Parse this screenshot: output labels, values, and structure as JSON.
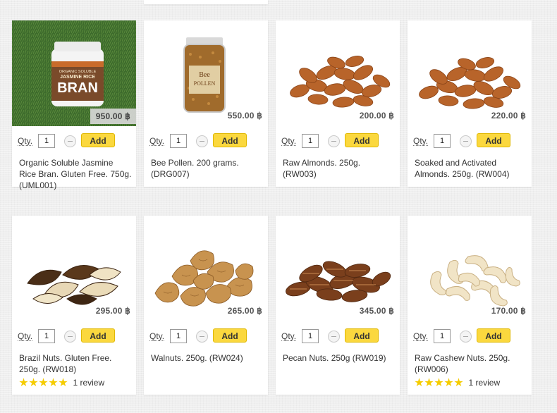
{
  "products": [
    {
      "name": "Organic Soluble Jasmine Rice Bran. Gluten Free. 750g. (UML001)",
      "price": "950.00 ฿",
      "qty": "1",
      "image_icon": "rice-bran-jar-icon",
      "reviews": ""
    },
    {
      "name": "Bee Pollen. 200 grams. (DRG007)",
      "price": "550.00 ฿",
      "qty": "1",
      "image_icon": "bee-pollen-jar-icon",
      "reviews": ""
    },
    {
      "name": "Raw Almonds. 250g. (RW003)",
      "price": "200.00 ฿",
      "qty": "1",
      "image_icon": "almonds-icon",
      "reviews": ""
    },
    {
      "name": "Soaked and Activated Almonds. 250g. (RW004)",
      "price": "220.00 ฿",
      "qty": "1",
      "image_icon": "almonds-icon",
      "reviews": ""
    },
    {
      "name": "Brazil Nuts. Gluten Free. 250g. (RW018)",
      "price": "295.00 ฿",
      "qty": "1",
      "image_icon": "brazil-nuts-icon",
      "reviews": "1 review",
      "stars": 5
    },
    {
      "name": "Walnuts. 250g. (RW024)",
      "price": "265.00 ฿",
      "qty": "1",
      "image_icon": "walnuts-icon",
      "reviews": ""
    },
    {
      "name": "Pecan Nuts. 250g (RW019)",
      "price": "345.00 ฿",
      "qty": "1",
      "image_icon": "pecans-icon",
      "reviews": ""
    },
    {
      "name": "Raw Cashew Nuts. 250g. (RW006)",
      "price": "170.00 ฿",
      "qty": "1",
      "image_icon": "cashews-icon",
      "reviews": "1 review",
      "stars": 5
    }
  ],
  "labels": {
    "qty": "Qty.",
    "add": "Add"
  },
  "jar_label": {
    "line1": "ORGANIC SOLUBLE",
    "line2": "JASMINE RICE",
    "line3": "BRAN",
    "bee1": "Bee",
    "bee2": "POLLEN"
  },
  "colors": {
    "add_button": "#fbd83e",
    "star": "#f5cc00",
    "grass": "#3f6a2e"
  }
}
